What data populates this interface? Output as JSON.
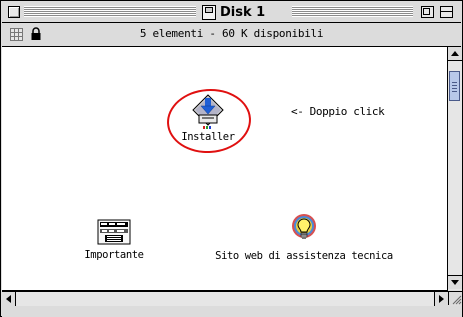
{
  "window": {
    "title": "Disk 1",
    "info": "5 elementi - 60 K disponibili"
  },
  "items": [
    {
      "label": "Installer",
      "icon": "installer-icon"
    },
    {
      "label": "Importante",
      "icon": "document-icon"
    },
    {
      "label": "Sito web di assistenza tecnica",
      "icon": "lightbulb-icon"
    }
  ],
  "annotation": {
    "text": "<- Doppio click",
    "circle_color": "#e01010"
  },
  "colors": {
    "chrome": "#dcdcdc",
    "content_bg": "#ffffff",
    "scroll_thumb": "#b8c8ea"
  }
}
